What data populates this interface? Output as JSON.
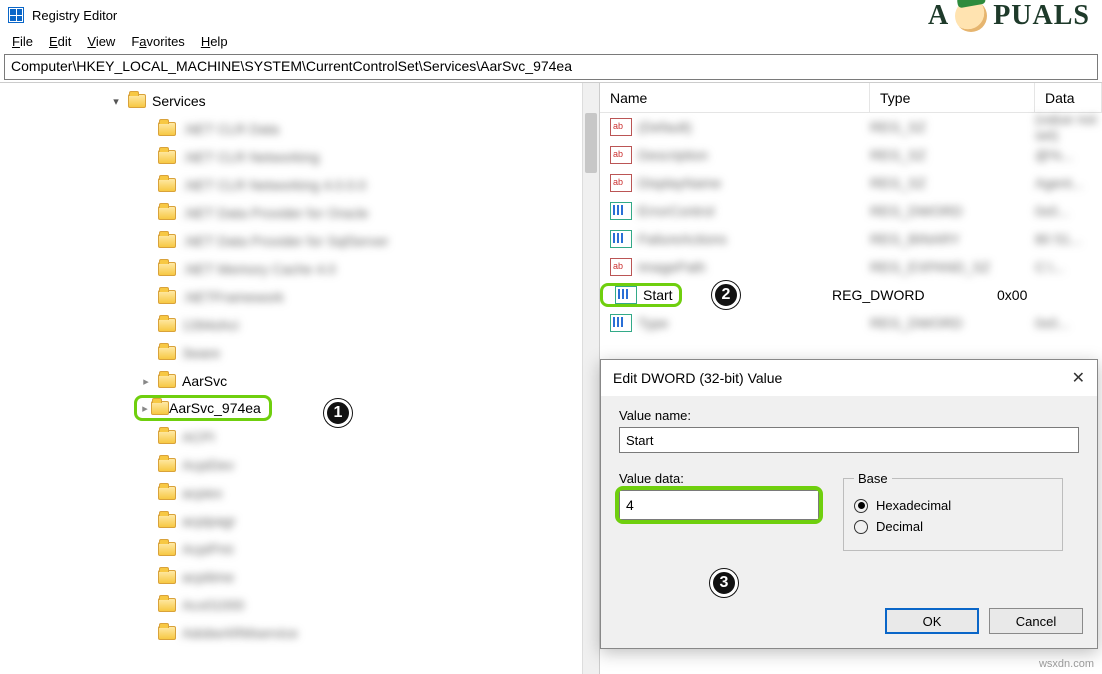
{
  "window": {
    "title": "Registry Editor"
  },
  "menu": {
    "file": "File",
    "edit": "Edit",
    "view": "View",
    "favorites": "Favorites",
    "help": "Help"
  },
  "address": "Computer\\HKEY_LOCAL_MACHINE\\SYSTEM\\CurrentControlSet\\Services\\AarSvc_974ea",
  "tree": {
    "parent": "Services",
    "items": [
      ".NET CLR Data",
      ".NET CLR Networking",
      ".NET CLR Networking 4.0.0.0",
      ".NET Data Provider for Oracle",
      ".NET Data Provider for SqlServer",
      ".NET Memory Cache 4.0",
      ".NETFramework",
      "1394ohci",
      "3ware",
      "AarSvc",
      "AarSvc_974ea",
      "ACPI",
      "AcpiDev",
      "acpiex",
      "acpipagr",
      "AcpiPmi",
      "acpitime",
      "Acx01000",
      "AdobeARMservice"
    ],
    "visible_index_aarsvc": 9,
    "highlight_index": 10
  },
  "values": {
    "columns": {
      "name": "Name",
      "type": "Type",
      "data": "Data"
    },
    "rows": [
      {
        "name": "(Default)",
        "type": "REG_SZ",
        "data": "(value not set)",
        "icon": "reg-sz"
      },
      {
        "name": "Description",
        "type": "REG_SZ",
        "data": "@%...",
        "icon": "reg-sz"
      },
      {
        "name": "DisplayName",
        "type": "REG_SZ",
        "data": "Agent...",
        "icon": "reg-sz"
      },
      {
        "name": "ErrorControl",
        "type": "REG_DWORD",
        "data": "0x0...",
        "icon": "reg-dw"
      },
      {
        "name": "FailureActions",
        "type": "REG_BINARY",
        "data": "80 51...",
        "icon": "reg-dw"
      },
      {
        "name": "ImagePath",
        "type": "REG_EXPAND_SZ",
        "data": "C:\\...",
        "icon": "reg-sz"
      },
      {
        "name": "Start",
        "type": "REG_DWORD",
        "data": "0x00",
        "icon": "reg-dw"
      },
      {
        "name": "Type",
        "type": "REG_DWORD",
        "data": "0x0...",
        "icon": "reg-dw"
      }
    ],
    "highlight_index": 6
  },
  "dialog": {
    "title": "Edit DWORD (32-bit) Value",
    "value_name_label": "Value name:",
    "value_name": "Start",
    "value_data_label": "Value data:",
    "value_data": "4",
    "base_label": "Base",
    "hex": "Hexadecimal",
    "dec": "Decimal",
    "base_selected": "hex",
    "ok": "OK",
    "cancel": "Cancel"
  },
  "annotations": {
    "one": "1",
    "two": "2",
    "three": "3"
  },
  "watermark": {
    "brand_left": "A",
    "brand_right": "PUALS",
    "site": "wsxdn.com"
  }
}
